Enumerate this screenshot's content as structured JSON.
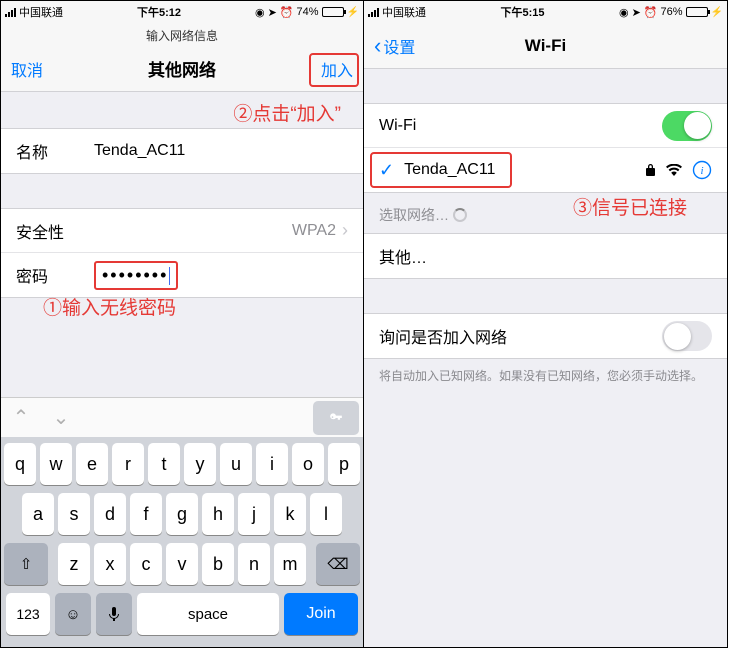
{
  "left": {
    "status": {
      "carrier": "中国联通",
      "time": "下午5:12",
      "battery": "74%"
    },
    "subnav": "输入网络信息",
    "nav": {
      "cancel": "取消",
      "title": "其他网络",
      "join": "加入"
    },
    "annot_join": "②点击“加入”",
    "rows": {
      "name_label": "名称",
      "name_value": "Tenda_AC11",
      "sec_label": "安全性",
      "sec_value": "WPA2",
      "pwd_label": "密码",
      "pwd_value": "••••••••"
    },
    "annot_pwd": "①输入无线密码",
    "keyboard": {
      "row1": [
        "q",
        "w",
        "e",
        "r",
        "t",
        "y",
        "u",
        "i",
        "o",
        "p"
      ],
      "row2": [
        "a",
        "s",
        "d",
        "f",
        "g",
        "h",
        "j",
        "k",
        "l"
      ],
      "row3": [
        "z",
        "x",
        "c",
        "v",
        "b",
        "n",
        "m"
      ],
      "num": "123",
      "space": "space",
      "join": "Join"
    }
  },
  "right": {
    "status": {
      "carrier": "中国联通",
      "time": "下午5:15",
      "battery": "76%"
    },
    "nav": {
      "back": "设置",
      "title": "Wi-Fi"
    },
    "rows": {
      "wifi_label": "Wi-Fi",
      "ssid": "Tenda_AC11",
      "choosing": "选取网络…",
      "other": "其他…",
      "ask_label": "询问是否加入网络"
    },
    "footer": "将自动加入已知网络。如果没有已知网络，您必须手动选择。",
    "annot_connected": "③信号已连接"
  }
}
